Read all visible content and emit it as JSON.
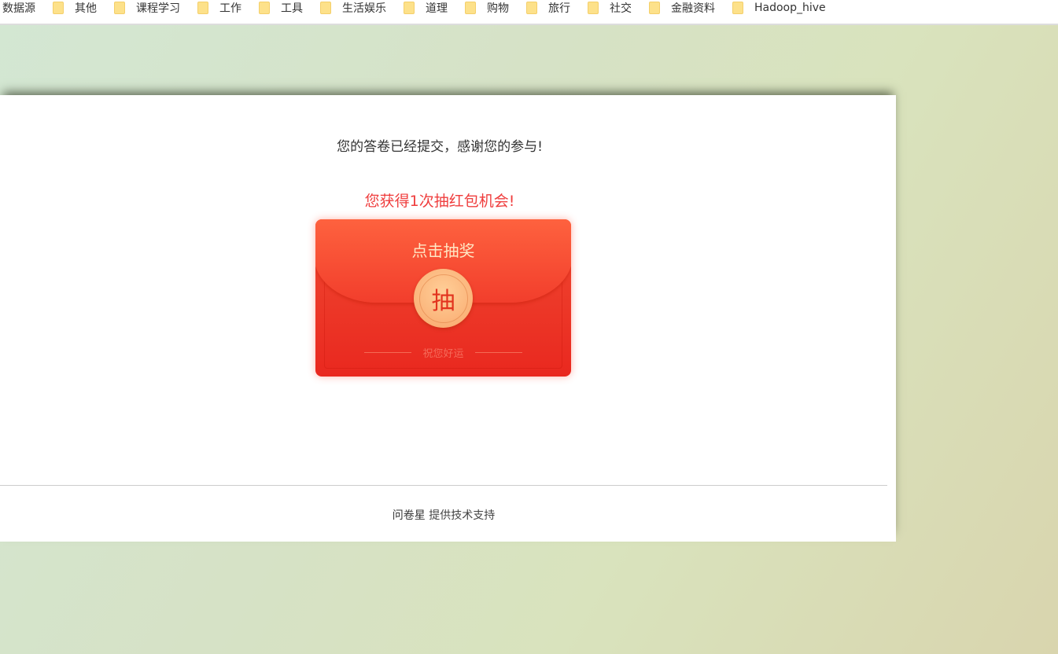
{
  "bookmarks": [
    "数据源",
    "其他",
    "课程学习",
    "工作",
    "工具",
    "生活娱乐",
    "道理",
    "购物",
    "旅行",
    "社交",
    "金融资料",
    "Hadoop_hive"
  ],
  "page": {
    "message": "您的答卷已经提交，感谢您的参与!",
    "chance": "您获得1次抽红包机会!",
    "envelope": {
      "title": "点击抽奖",
      "coin": "抽",
      "wish": "祝您好运"
    },
    "footer": {
      "brand": "问卷星",
      "support": "提供技术支持"
    }
  },
  "colors": {
    "accent": "#ef3d3d",
    "envelope": "#e9281f"
  }
}
